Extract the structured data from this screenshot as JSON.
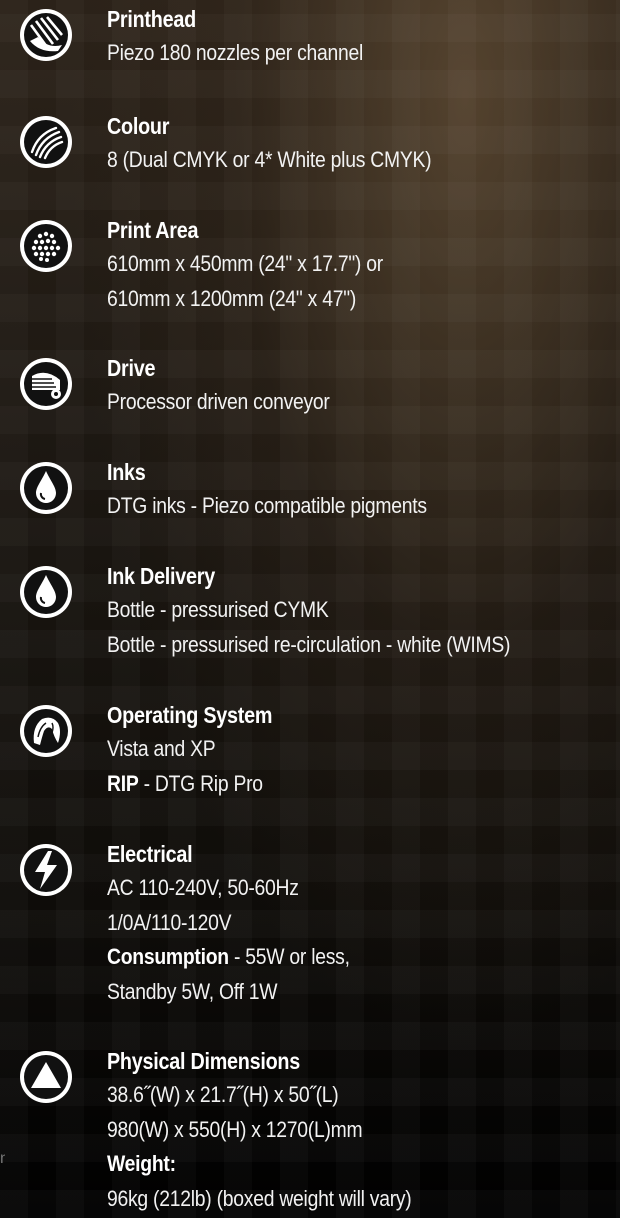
{
  "specs": [
    {
      "icon": "printhead-icon",
      "title": "Printhead",
      "lines": [
        "Piezo 180 nozzles per channel"
      ]
    },
    {
      "icon": "colour-icon",
      "title": "Colour",
      "lines": [
        "8 (Dual CMYK or 4* White plus CMYK)"
      ]
    },
    {
      "icon": "print-area-icon",
      "title": "Print Area",
      "lines": [
        "610mm x 450mm (24\" x 17.7\") or",
        "610mm x 1200mm (24\" x 47\")"
      ]
    },
    {
      "icon": "drive-icon",
      "title": "Drive",
      "lines": [
        "Processor driven conveyor"
      ]
    },
    {
      "icon": "ink-drop-icon",
      "title": "Inks",
      "lines": [
        "DTG inks - Piezo compatible pigments"
      ]
    },
    {
      "icon": "ink-drop-icon",
      "title": "Ink Delivery",
      "lines": [
        "Bottle - pressurised CYMK",
        "Bottle - pressurised re-circulation - white (WIMS)"
      ]
    },
    {
      "icon": "operating-system-icon",
      "title": "Operating System",
      "lines": [
        "Vista and XP"
      ],
      "rip_label": "RIP",
      "rip_value": " - DTG Rip Pro"
    },
    {
      "icon": "lightning-bolt-icon",
      "title": "Electrical",
      "lines": [
        "AC 110-240V, 50-60Hz",
        "1/0A/110-120V"
      ],
      "consumption_label": "Consumption",
      "consumption_value": " - 55W or less,",
      "extra_line": "Standby 5W, Off 1W"
    },
    {
      "icon": "triangle-dimensions-icon",
      "title": "Physical Dimensions",
      "lines": [
        "38.6˝(W) x 21.7˝(H) x 50˝(L)",
        "980(W) x 550(H) x 1270(L)mm"
      ],
      "weight_label": "Weight:",
      "weight_value": "96kg (212lb) (boxed weight will vary)"
    }
  ],
  "edge_mark": "n"
}
